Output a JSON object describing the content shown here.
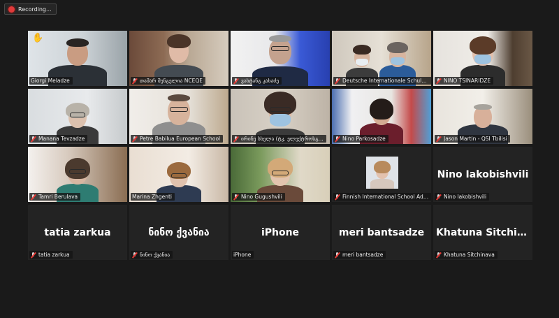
{
  "recording": {
    "label": "Recording..."
  },
  "participants": [
    {
      "name": "Giorgi Meladze",
      "type": "video",
      "active": true,
      "hand": "✋"
    },
    {
      "name": "თამარ შენგელია NCEQE",
      "type": "video"
    },
    {
      "name": "ვახტანგ კახაძე",
      "type": "video"
    },
    {
      "name": "Deutsche Internationale Schule T...",
      "type": "video"
    },
    {
      "name": "NINO TSINARIDZE",
      "type": "video"
    },
    {
      "name": "Manana Tevzadze",
      "type": "video"
    },
    {
      "name": "Petre Babilua European School",
      "type": "video"
    },
    {
      "name": "ირინე სხელა (ტკ. ელექტროსგ...",
      "type": "video"
    },
    {
      "name": "Nino Parkosadze",
      "type": "video"
    },
    {
      "name": "Jason Martin - QSI Tbilisi",
      "type": "video"
    },
    {
      "name": "Tamri Berulava",
      "type": "video"
    },
    {
      "name": "Marina Zhgenti",
      "type": "video"
    },
    {
      "name": "Nino Gugushvili",
      "type": "video"
    },
    {
      "name": "Finnish International School Admi...",
      "type": "photo"
    },
    {
      "name": "Nino Iakobishvili",
      "type": "name",
      "display": "Nino Iakobishvili"
    },
    {
      "name": "tatia zarkua",
      "type": "name",
      "display": "tatia zarkua"
    },
    {
      "name": "ნინო ქვანია",
      "type": "name",
      "display": "ნინო ქვანია"
    },
    {
      "name": "iPhone",
      "type": "name",
      "display": "iPhone"
    },
    {
      "name": "meri bantsadze",
      "type": "name",
      "display": "meri bantsadze"
    },
    {
      "name": "Khatuna Sitchinava",
      "type": "name",
      "display": "Khatuna Sitchin..."
    }
  ],
  "colors": {
    "active_border": "#c5e24a",
    "record_dot": "#e03a3a",
    "mic_off": "#e53935"
  }
}
